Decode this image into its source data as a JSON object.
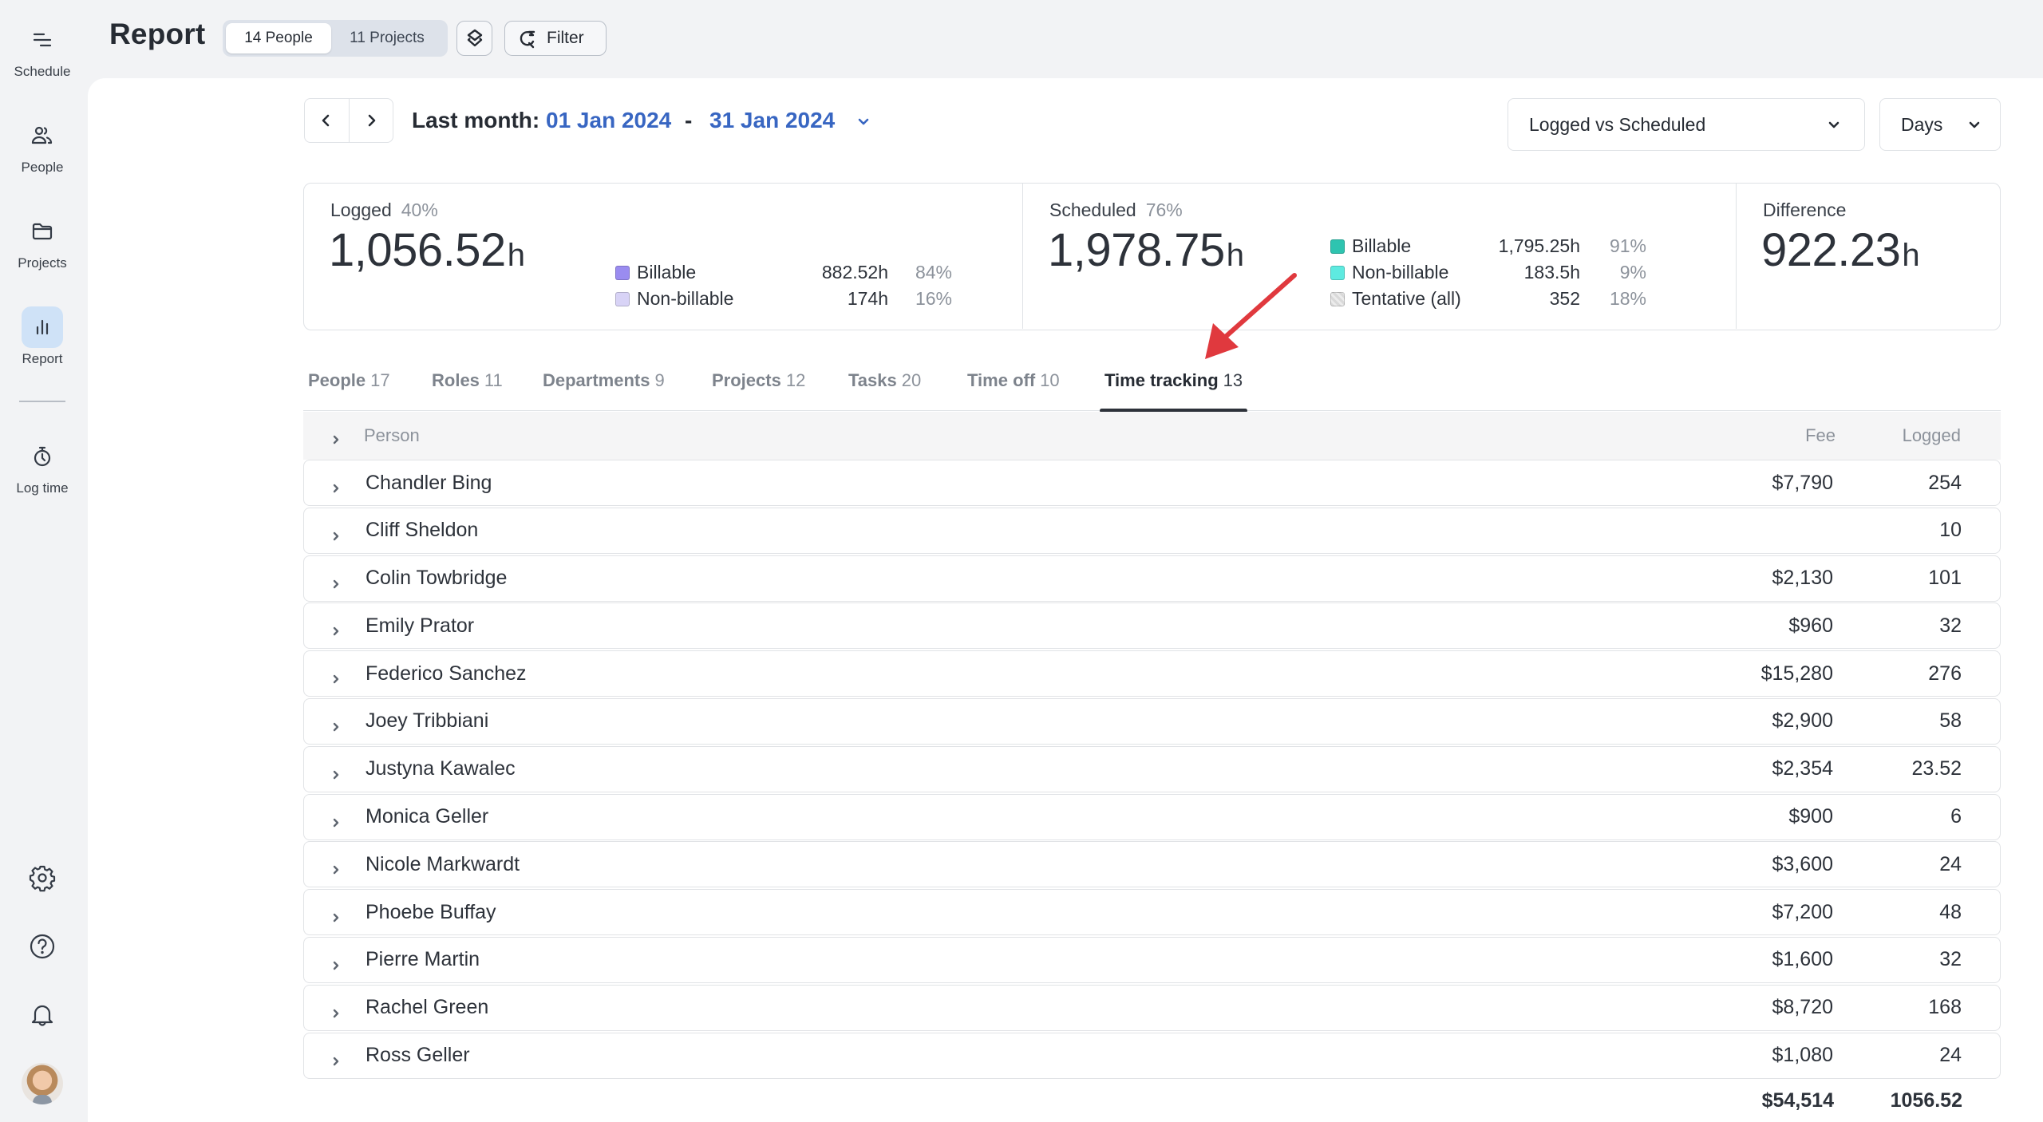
{
  "sidebar": {
    "items": [
      {
        "id": "schedule",
        "label": "Schedule",
        "icon": "schedule-icon",
        "active": false
      },
      {
        "id": "people",
        "label": "People",
        "icon": "people-icon",
        "active": false
      },
      {
        "id": "projects",
        "label": "Projects",
        "icon": "folder-icon",
        "active": false
      },
      {
        "id": "report",
        "label": "Report",
        "icon": "bar-chart-icon",
        "active": true
      },
      {
        "id": "log-time",
        "label": "Log time",
        "icon": "stopwatch-icon",
        "active": false
      }
    ],
    "bottom_icons": [
      "gear-icon",
      "help-icon",
      "bell-icon",
      "avatar"
    ]
  },
  "header": {
    "title": "Report",
    "segments": [
      {
        "label": "14 People",
        "active": true
      },
      {
        "label": "11 Projects",
        "active": false
      }
    ],
    "filter_label": "Filter"
  },
  "date_range": {
    "label": "Last month:",
    "start": "01 Jan 2024",
    "separator": "-",
    "end": "31 Jan 2024"
  },
  "controls": {
    "metric_select": "Logged vs Scheduled",
    "unit_select": "Days"
  },
  "summary": {
    "logged": {
      "title": "Logged",
      "pct": "40%",
      "value": "1,056.52",
      "unit": "h",
      "legend": [
        {
          "name": "Billable",
          "hours": "882.52h",
          "pct": "84%",
          "color": "#9a8cf0"
        },
        {
          "name": "Non-billable",
          "hours": "174h",
          "pct": "16%",
          "color": "#d8d3f6"
        }
      ]
    },
    "scheduled": {
      "title": "Scheduled",
      "pct": "76%",
      "value": "1,978.75",
      "unit": "h",
      "legend": [
        {
          "name": "Billable",
          "hours": "1,795.25h",
          "pct": "91%",
          "color": "#2ec4b0"
        },
        {
          "name": "Non-billable",
          "hours": "183.5h",
          "pct": "9%",
          "color": "#5eeae0"
        },
        {
          "name": "Tentative (all)",
          "hours": "352",
          "pct": "18%",
          "color": "#d9d9d9"
        }
      ]
    },
    "difference": {
      "title": "Difference",
      "value": "922.23",
      "unit": "h"
    }
  },
  "tabs": [
    {
      "label": "People",
      "count": "17",
      "active": false
    },
    {
      "label": "Roles",
      "count": "11",
      "active": false
    },
    {
      "label": "Departments",
      "count": "9",
      "active": false
    },
    {
      "label": "Projects",
      "count": "12",
      "active": false
    },
    {
      "label": "Tasks",
      "count": "20",
      "active": false
    },
    {
      "label": "Time off",
      "count": "10",
      "active": false
    },
    {
      "label": "Time tracking",
      "count": "13",
      "active": true
    }
  ],
  "table": {
    "columns": {
      "person": "Person",
      "fee": "Fee",
      "logged": "Logged"
    },
    "rows": [
      {
        "name": "Chandler Bing",
        "fee": "$7,790",
        "logged": "254"
      },
      {
        "name": "Cliff Sheldon",
        "fee": "",
        "logged": "10"
      },
      {
        "name": "Colin Towbridge",
        "fee": "$2,130",
        "logged": "101"
      },
      {
        "name": "Emily Prator",
        "fee": "$960",
        "logged": "32"
      },
      {
        "name": "Federico Sanchez",
        "fee": "$15,280",
        "logged": "276"
      },
      {
        "name": "Joey Tribbiani",
        "fee": "$2,900",
        "logged": "58"
      },
      {
        "name": "Justyna Kawalec",
        "fee": "$2,354",
        "logged": "23.52"
      },
      {
        "name": "Monica Geller",
        "fee": "$900",
        "logged": "6"
      },
      {
        "name": "Nicole Markwardt",
        "fee": "$3,600",
        "logged": "24"
      },
      {
        "name": "Phoebe Buffay",
        "fee": "$7,200",
        "logged": "48"
      },
      {
        "name": "Pierre Martin",
        "fee": "$1,600",
        "logged": "32"
      },
      {
        "name": "Rachel Green",
        "fee": "$8,720",
        "logged": "168"
      },
      {
        "name": "Ross Geller",
        "fee": "$1,080",
        "logged": "24"
      }
    ],
    "totals": {
      "fee": "$54,514",
      "logged": "1056.52"
    }
  },
  "colors": {
    "accent_blue": "#3866c2",
    "active_nav_bg": "#cfe2f7",
    "annotation_arrow": "#e0393e"
  }
}
